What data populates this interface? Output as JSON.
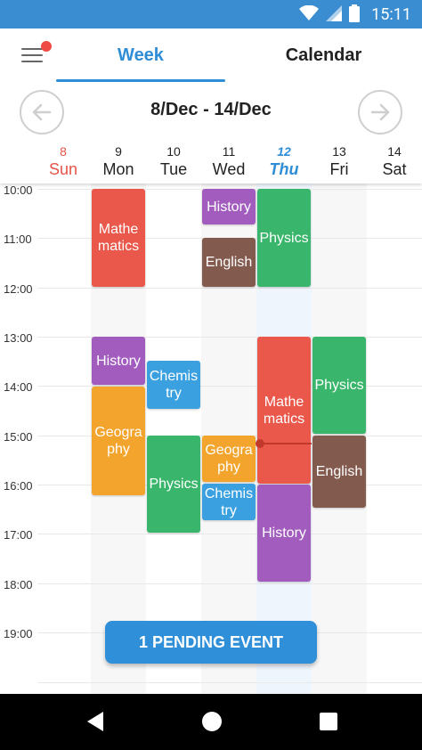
{
  "status": {
    "time": "15:11"
  },
  "tabs": {
    "week": "Week",
    "calendar": "Calendar"
  },
  "range": "8/Dec - 14/Dec",
  "days": [
    {
      "num": "8",
      "name": "Sun"
    },
    {
      "num": "9",
      "name": "Mon"
    },
    {
      "num": "10",
      "name": "Tue"
    },
    {
      "num": "11",
      "name": "Wed"
    },
    {
      "num": "12",
      "name": "Thu"
    },
    {
      "num": "13",
      "name": "Fri"
    },
    {
      "num": "14",
      "name": "Sat"
    }
  ],
  "times": [
    "10:00",
    "11:00",
    "12:00",
    "13:00",
    "14:00",
    "15:00",
    "16:00",
    "17:00",
    "18:00",
    "19:00"
  ],
  "events": {
    "mon_math": "Mathematics",
    "mon_history": "History",
    "mon_geo": "Geography",
    "tue_chem": "Chemistry",
    "tue_phys": "Physics",
    "wed_history": "History",
    "wed_english": "English",
    "wed_geo": "Geography",
    "wed_chem": "Chemistry",
    "thu_phys": "Physics",
    "thu_math": "Mathematics",
    "thu_history": "History",
    "fri_phys": "Physics",
    "fri_english": "English"
  },
  "pending": "1 PENDING EVENT",
  "colors": {
    "primary": "#2f8dd6",
    "math": "#e9584a",
    "history": "#a25cbe",
    "english": "#835a4e",
    "physics": "#39b66b",
    "geography": "#f3a42c",
    "chemistry": "#3aa0e0"
  },
  "icons": [
    "wifi-icon",
    "signal-icon",
    "battery-icon",
    "menu-icon",
    "arrow-left-icon",
    "arrow-right-icon",
    "back-icon",
    "home-icon",
    "recents-icon"
  ]
}
